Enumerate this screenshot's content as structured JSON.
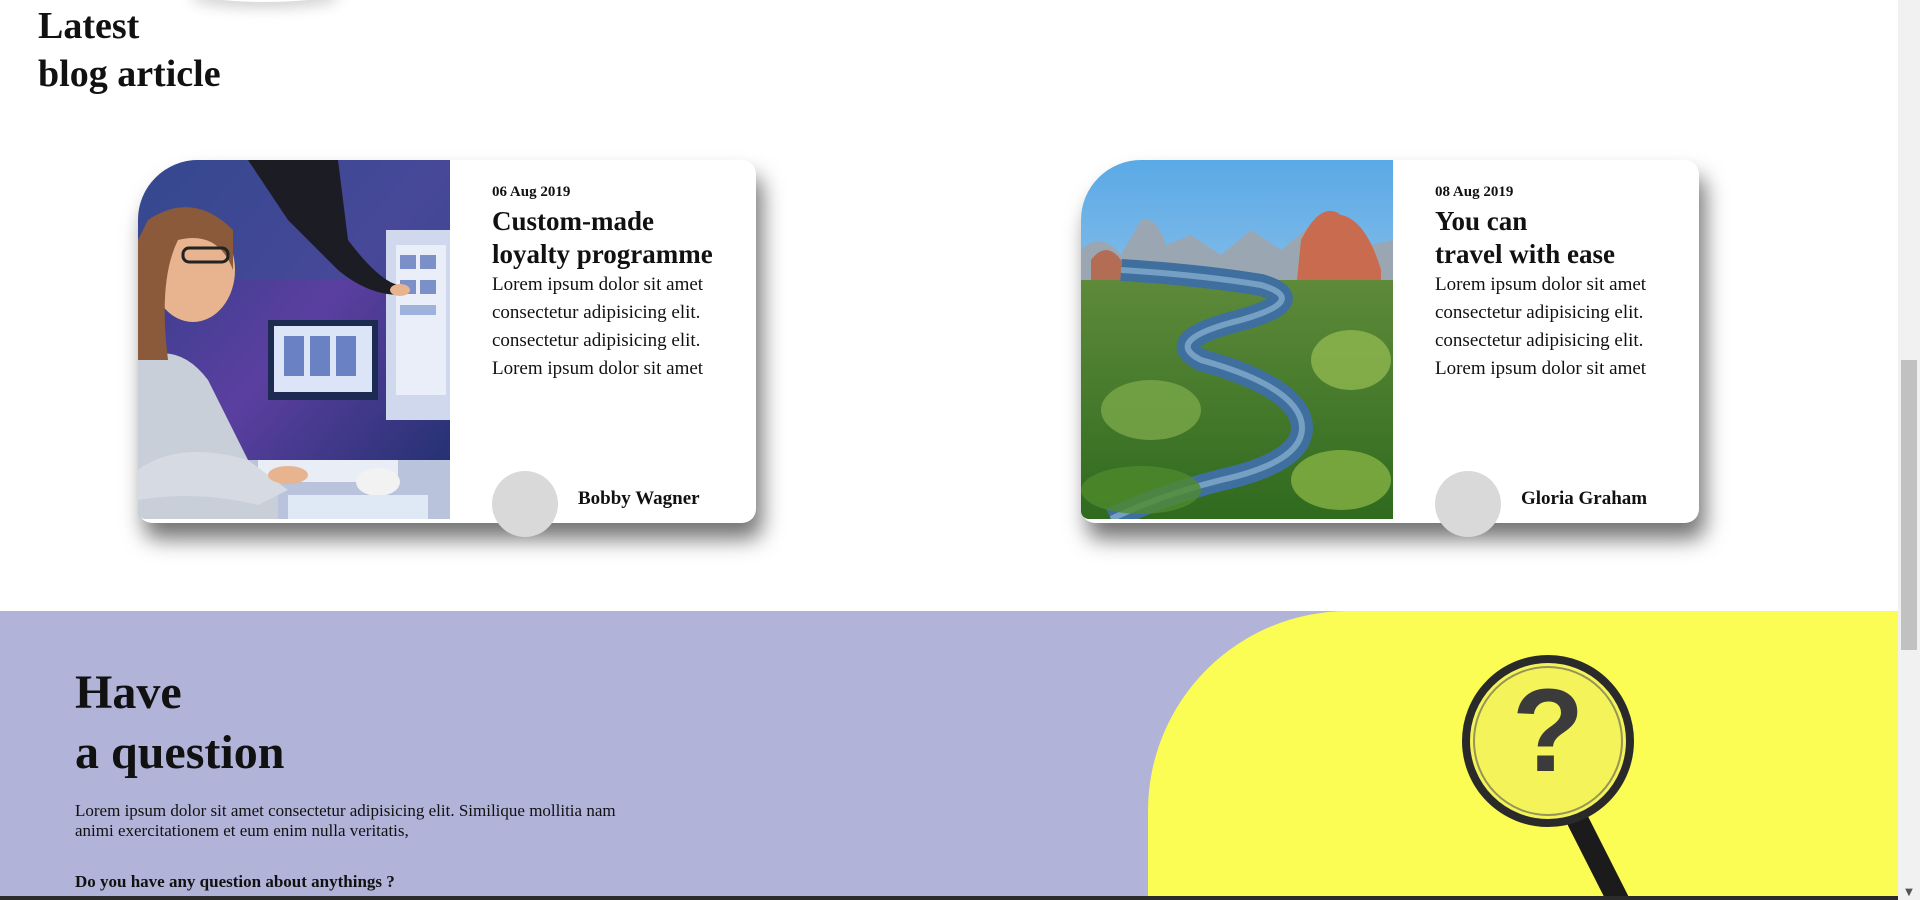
{
  "blog": {
    "title_line1": "Latest",
    "title_line2": "blog article",
    "cards": [
      {
        "date": "06 Aug 2019",
        "title_line1": "Custom-made",
        "title_line2": "loyalty programme",
        "text_lines": [
          "Lorem ipsum dolor sit amet",
          "consectetur adipisicing elit.",
          "consectetur adipisicing elit.",
          "Lorem ipsum dolor sit amet"
        ],
        "author": "Bobby Wagner",
        "image": "person-at-computer-photo"
      },
      {
        "date": "08 Aug 2019",
        "title_line1": "You can",
        "title_line2": "travel with ease",
        "text_lines": [
          "Lorem ipsum dolor sit amet",
          "consectetur adipisicing elit.",
          "consectetur adipisicing elit.",
          "Lorem ipsum dolor sit amet"
        ],
        "author": "Gloria Graham",
        "image": "river-landscape-photo"
      }
    ]
  },
  "question": {
    "title_line1": "Have",
    "title_line2": "a question",
    "text": "Lorem ipsum dolor sit amet consectetur adipisicing elit. Similique mollitia nam animi exercitationem et eum enim nulla veritatis,",
    "ask": "Do you have any question about anythings ?",
    "image": "magnifying-glass-question-icon"
  },
  "colors": {
    "question_bg": "#b1b3d9",
    "yellow_panel": "#fbfc54",
    "avatar": "#d9d9d9"
  },
  "scrollbar": {
    "down_arrow": "▼"
  }
}
